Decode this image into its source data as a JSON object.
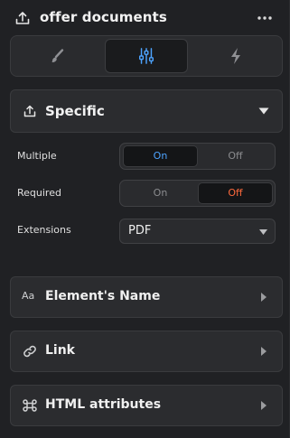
{
  "header": {
    "title": "offer documents",
    "icon": "upload-icon",
    "more_icon": "more-dots-icon"
  },
  "tabs": [
    {
      "icon": "brush-icon",
      "active": false
    },
    {
      "icon": "sliders-icon",
      "active": true
    },
    {
      "icon": "lightning-icon",
      "active": false
    }
  ],
  "section": {
    "label": "Specific",
    "icon": "upload-icon"
  },
  "fields": {
    "multiple": {
      "label": "Multiple",
      "on": "On",
      "off": "Off",
      "selected": "On"
    },
    "required": {
      "label": "Required",
      "on": "On",
      "off": "Off",
      "selected": "Off"
    },
    "extensions": {
      "label": "Extensions",
      "value": "PDF"
    }
  },
  "cards": [
    {
      "label": "Element's Name",
      "icon_text": "Aa"
    },
    {
      "label": "Link",
      "icon": "link-icon"
    },
    {
      "label": "HTML attributes",
      "icon": "command-icon"
    }
  ],
  "colors": {
    "on_blue": "#4da3ff",
    "off_red": "#ff6a3d"
  }
}
